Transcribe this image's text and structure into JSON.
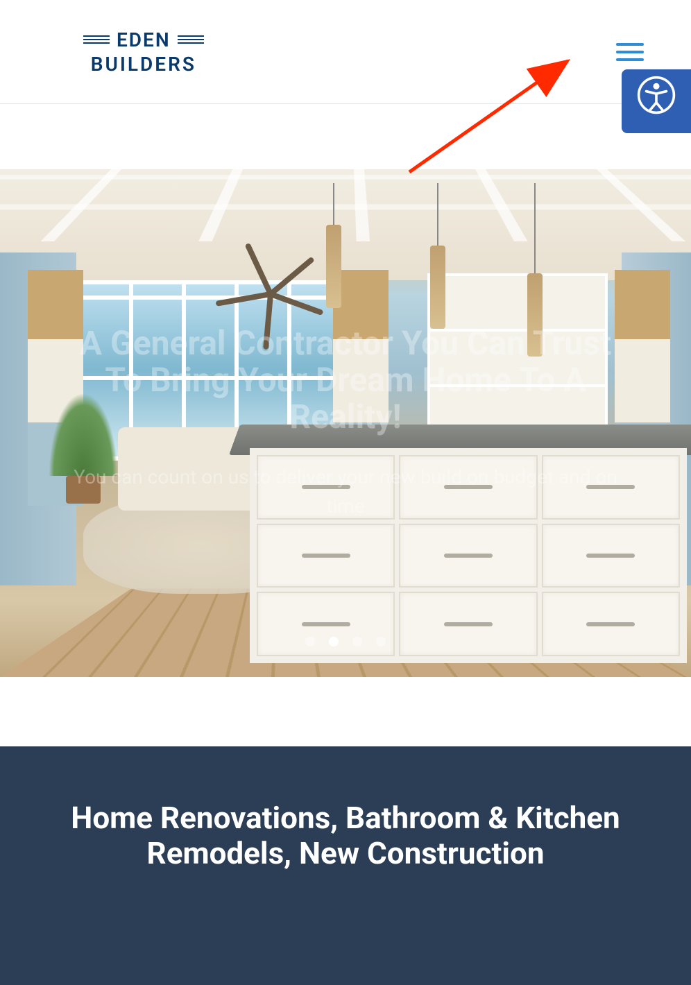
{
  "header": {
    "logo_top": "EDEN",
    "logo_bottom": "BUILDERS"
  },
  "accessibility": {
    "icon_name": "accessibility-icon"
  },
  "hero": {
    "heading_faint": "A General Contractor You Can Trust To Bring Your Dream Home To A Reality!",
    "subtext_faint": "You can count on us to deliver your new build on budget and on time",
    "carousel": {
      "total": 4,
      "active_index": 1
    }
  },
  "bottom": {
    "heading": "Home Renovations, Bathroom & Kitchen Remodels, New Construction"
  },
  "annotation": {
    "arrow_target": "hamburger-menu"
  }
}
